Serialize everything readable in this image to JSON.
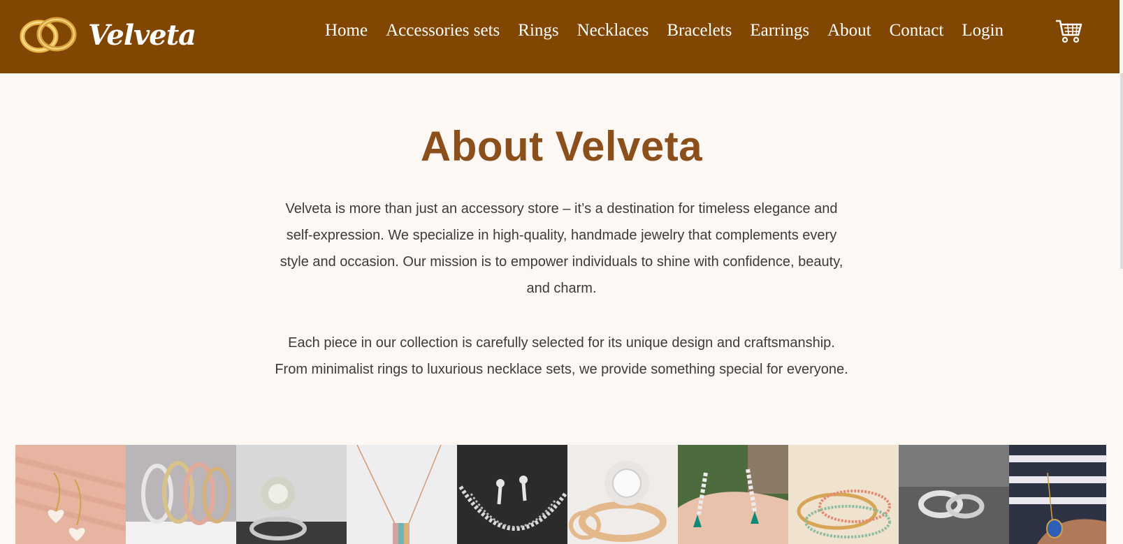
{
  "header": {
    "brand": "Velveta",
    "logo_icon": "gold-rings-icon",
    "nav": [
      "Home",
      "Accessories sets",
      "Rings",
      "Necklaces",
      "Bracelets",
      "Earrings",
      "About",
      "Contact",
      "Login"
    ],
    "cart_icon": "shopping-cart-icon",
    "colors": {
      "background": "#824603",
      "text": "#ffffff"
    }
  },
  "about": {
    "title": "About Velveta",
    "paragraph1": "Velveta is more than just an accessory store – it’s a destination for timeless elegance and self-expression. We specialize in high-quality, handmade jewelry that complements every style and occasion. Our mission is to empower individuals to shine with confidence, beauty, and charm.",
    "paragraph2": "Each piece in our collection is carefully selected for its unique design and craftsmanship. From minimalist rings to luxurious necklace sets, we provide something special for everyone.",
    "colors": {
      "title": "#8b4f1c",
      "page_background": "#fdf8f4"
    }
  },
  "gallery": {
    "images": [
      "heart-earrings-image",
      "bangles-image",
      "diamond-ring-image",
      "pendant-necklace-image",
      "necklace-set-image",
      "halo-ring-image",
      "emerald-earrings-image",
      "beaded-bracelets-image",
      "wedding-bands-image",
      "sapphire-pendant-image"
    ]
  }
}
